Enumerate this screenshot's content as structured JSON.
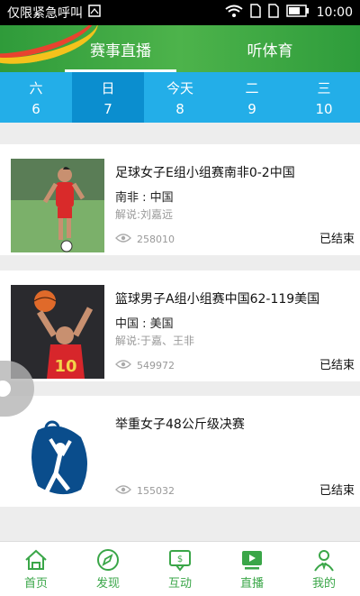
{
  "status_bar": {
    "carrier_text": "仅限紧急呼叫",
    "time": "10:00"
  },
  "header": {
    "tabs": [
      {
        "label": "赛事直播",
        "active": true
      },
      {
        "label": "听体育",
        "active": false
      }
    ]
  },
  "dates": [
    {
      "weekday": "六",
      "day": "6",
      "active": false
    },
    {
      "weekday": "日",
      "day": "7",
      "active": true
    },
    {
      "weekday": "今天",
      "day": "8",
      "active": false
    },
    {
      "weekday": "二",
      "day": "9",
      "active": false
    },
    {
      "weekday": "三",
      "day": "10",
      "active": false
    }
  ],
  "events": [
    {
      "title": "足球女子E组小组赛南非0-2中国",
      "teams": "南非 : 中国",
      "commentary": "解说:刘嘉远",
      "views": "258010",
      "status": "已结束"
    },
    {
      "title": "篮球男子A组小组赛中国62-119美国",
      "teams": "中国 : 美国",
      "commentary": "解说:于嘉、王非",
      "views": "549972",
      "status": "已结束"
    },
    {
      "title": "举重女子48公斤级决赛",
      "teams": "",
      "commentary": "",
      "views": "155032",
      "status": "已结束"
    }
  ],
  "bottom_nav": [
    {
      "label": "首页",
      "icon": "home-icon"
    },
    {
      "label": "发现",
      "icon": "compass-icon"
    },
    {
      "label": "互动",
      "icon": "chat-icon"
    },
    {
      "label": "直播",
      "icon": "play-icon"
    },
    {
      "label": "我的",
      "icon": "user-icon"
    }
  ],
  "colors": {
    "brand_green": "#3aa648",
    "date_blue": "#23aee8",
    "date_active": "#0b8ecf"
  }
}
